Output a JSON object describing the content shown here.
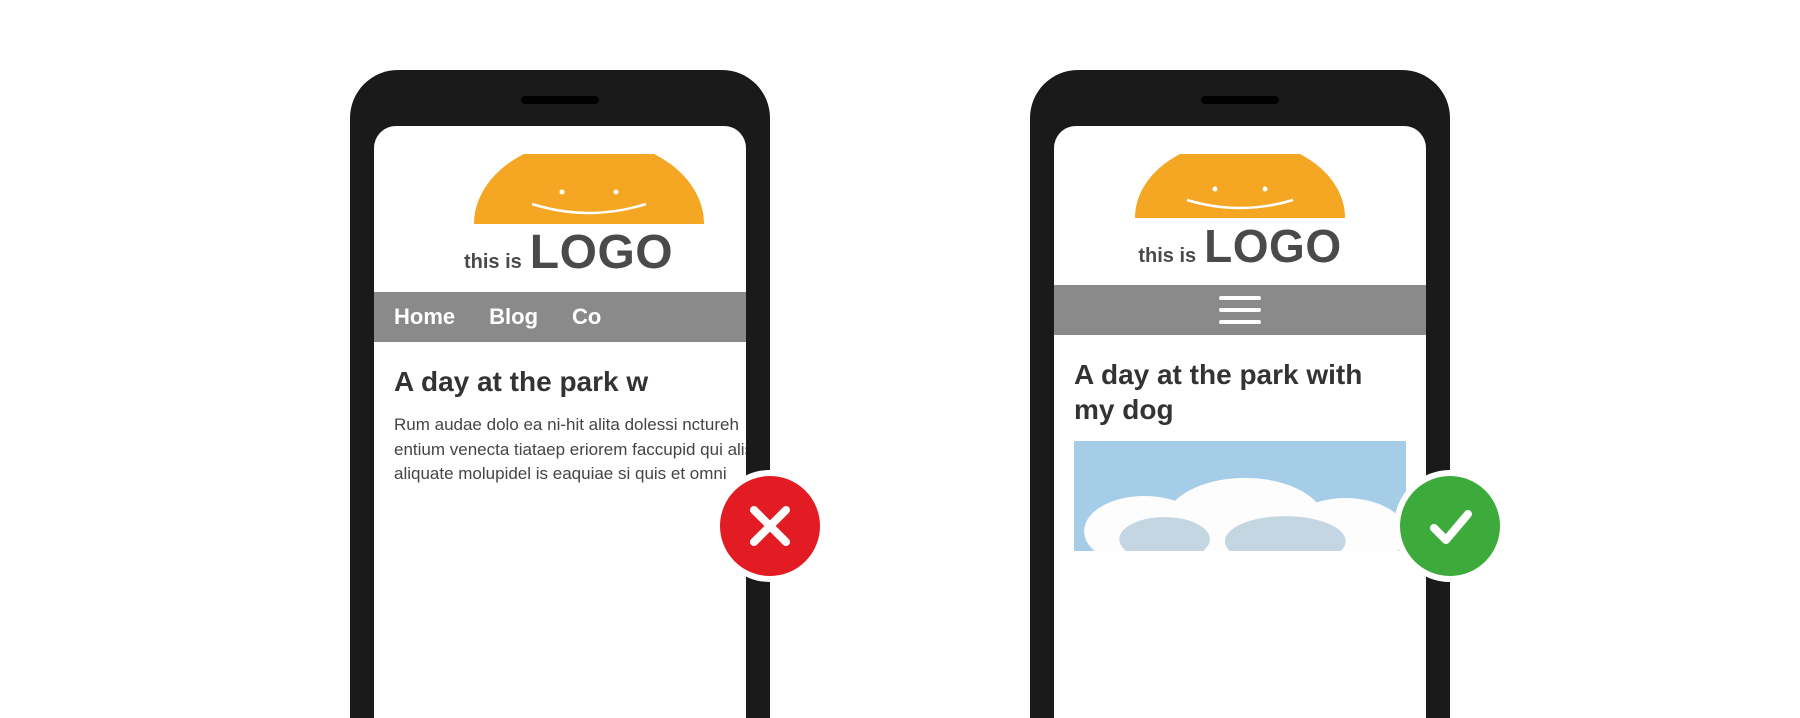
{
  "logo": {
    "prefix": "this is",
    "main": "LOGO",
    "color_shape": "#f5a623",
    "color_text": "#4a4a4a"
  },
  "left": {
    "nav_items": [
      "Home",
      "Blog",
      "Co"
    ],
    "heading": "A day at the park w",
    "body": "Rum audae dolo ea ni-hit alita dolessi nctureh entium venecta tiataep eriorem faccupid qui alis aliquate molupidel is eaquiae si quis et omni",
    "status": "bad"
  },
  "right": {
    "heading": "A day at the park with my dog",
    "status": "good"
  },
  "colors": {
    "navbar": "#8a8a8a",
    "bad": "#e31b23",
    "good": "#3cab3c",
    "phone": "#1a1a1a"
  }
}
